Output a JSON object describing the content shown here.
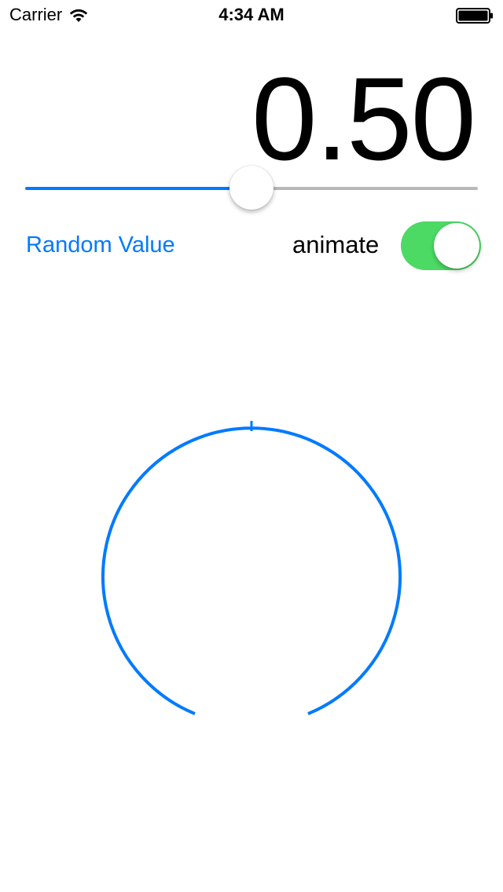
{
  "status_bar": {
    "carrier": "Carrier",
    "time": "4:34 AM",
    "wifi_icon": "wifi-icon",
    "battery_icon": "battery-icon"
  },
  "value_display": {
    "text": "0.50"
  },
  "slider": {
    "value": 0.5,
    "min": 0,
    "max": 1,
    "min_track_color": "#007aff",
    "max_track_color": "#b8b8b8"
  },
  "random_button": {
    "label": "Random Value",
    "color": "#007aff"
  },
  "animate": {
    "label": "animate",
    "on": true,
    "on_color": "#4cd964"
  },
  "gauge": {
    "value": 0.5,
    "stroke_color": "#007aff",
    "arc_gap_at_bottom": true
  }
}
